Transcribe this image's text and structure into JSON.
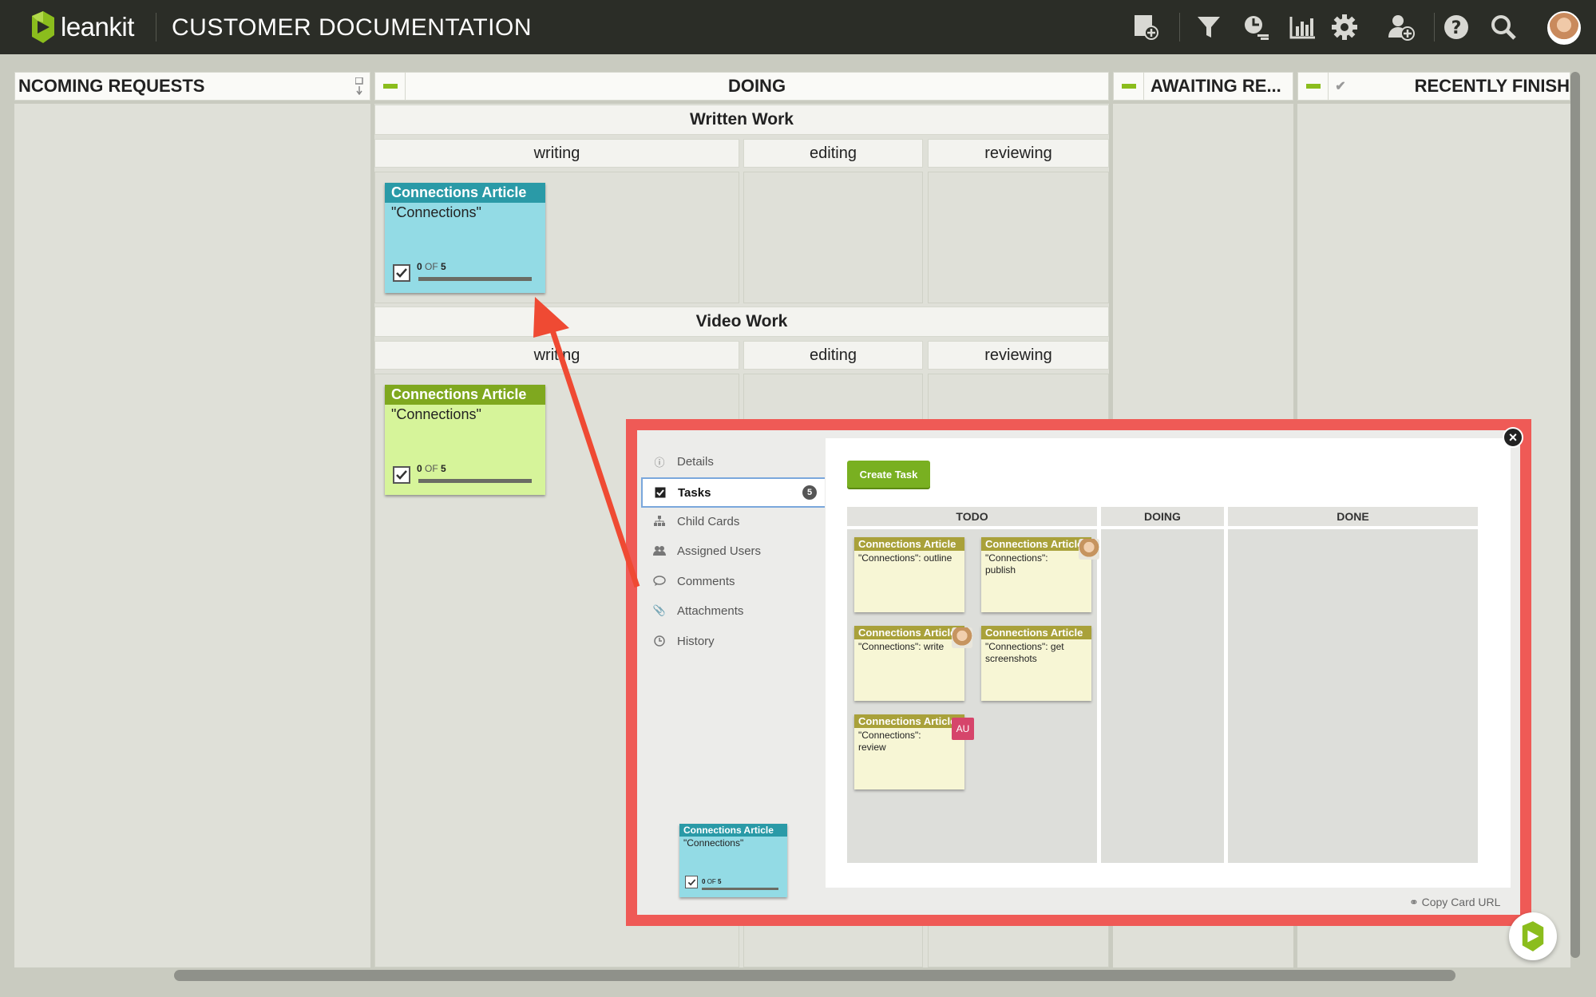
{
  "app": {
    "logo_text": "leankit",
    "board_title": "CUSTOMER DOCUMENTATION"
  },
  "toolbar": {
    "icons": [
      "add-card-icon",
      "filter-icon",
      "activity-icon",
      "reports-icon",
      "settings-icon",
      "add-user-icon",
      "help-icon",
      "search-icon",
      "user-avatar"
    ]
  },
  "lanes": {
    "incoming": "NCOMING REQUESTS",
    "doing": "DOING",
    "awaiting": "AWAITING RE...",
    "finished": "RECENTLY FINISH"
  },
  "doing": {
    "written_work": "Written Work",
    "video_work": "Video Work",
    "sub_writing": "writing",
    "sub_editing": "editing",
    "sub_reviewing": "reviewing"
  },
  "cards": {
    "written": {
      "title": "Connections Article",
      "body": "\"Connections\"",
      "done": "0",
      "of": "OF",
      "total": "5",
      "color": "#2a9aa7",
      "body_color": "#93dbe5"
    },
    "video": {
      "title": "Connections Article",
      "body": "\"Connections\"",
      "done": "0",
      "of": "OF",
      "total": "5",
      "color": "#7fa81f",
      "body_color": "#d6f49a"
    }
  },
  "modal": {
    "sidebar": [
      {
        "label": "Details",
        "icon": "info-icon"
      },
      {
        "label": "Tasks",
        "icon": "checkbox-icon",
        "badge": "5"
      },
      {
        "label": "Child Cards",
        "icon": "hierarchy-icon"
      },
      {
        "label": "Assigned Users",
        "icon": "users-icon"
      },
      {
        "label": "Comments",
        "icon": "comment-icon"
      },
      {
        "label": "Attachments",
        "icon": "paperclip-icon"
      },
      {
        "label": "History",
        "icon": "clock-icon"
      }
    ],
    "create_task": "Create Task",
    "columns": [
      "TODO",
      "DOING",
      "DONE"
    ],
    "tasks": [
      {
        "title": "Connections Article",
        "body": "\"Connections\": outline"
      },
      {
        "title": "Connections Article",
        "body": "\"Connections\": publish"
      },
      {
        "title": "Connections Article",
        "body": "\"Connections\": write"
      },
      {
        "title": "Connections Article",
        "body": "\"Connections\": get screenshots"
      },
      {
        "title": "Connections Article",
        "body": "\"Connections\": review",
        "badge": "AU"
      }
    ],
    "mini_card": {
      "title": "Connections Article",
      "body": "\"Connections\"",
      "done": "0",
      "of": "OF",
      "total": "5"
    },
    "copy_url": "Copy Card URL",
    "close": "×"
  }
}
